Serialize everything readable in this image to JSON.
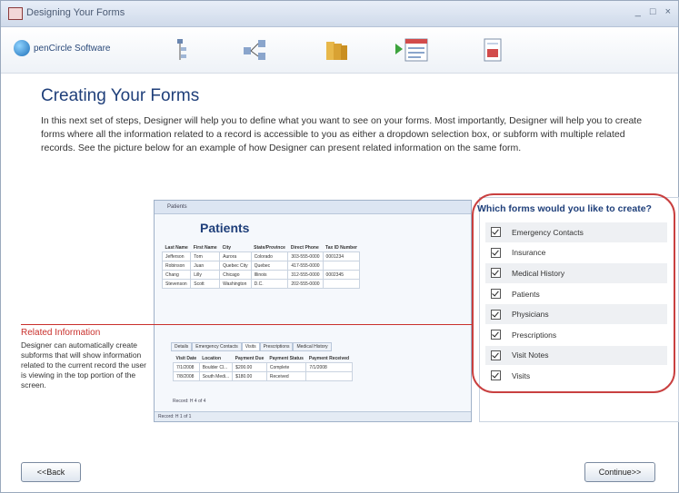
{
  "window": {
    "title": "Designing Your Forms",
    "controls": [
      "_",
      "□",
      "×"
    ]
  },
  "toolbar": {
    "logo_text": "penCircle Software",
    "steps": [
      "tree-icon",
      "diagram-icon",
      "folders-icon",
      "form-icon",
      "report-icon"
    ]
  },
  "heading": "Creating Your Forms",
  "intro": "In this next set of steps, Designer will help you to define what you want to see on your forms.  Most importantly, Designer will help you to create forms where all the information related to a record is accessible to you as either a dropdown selection box, or subform with multiple related records.  See the picture below for  an example of how Designer can present related information on the same form.",
  "preview": {
    "window_title": "Patients",
    "heading": "Patients",
    "columns": [
      "Last Name",
      "First Name",
      "City",
      "State/Province",
      "Direct Phone",
      "Tax ID Number"
    ],
    "rows": [
      [
        "Jefferson",
        "Tom",
        "Aurora",
        "Colorado",
        "303-555-0000",
        "0001234"
      ],
      [
        "Robinson",
        "Juan",
        "Quebec City",
        "Quebec",
        "417-555-0000",
        ""
      ],
      [
        "Chang",
        "Lilly",
        "Chicago",
        "Illinois",
        "312-555-0000",
        "0002345"
      ],
      [
        "Stevenson",
        "Scott",
        "Washington",
        "D.C.",
        "202-555-0000",
        ""
      ]
    ],
    "subtabs": [
      "Details",
      "Emergency Contacts",
      "Visits",
      "Prescriptions",
      "Medical History"
    ],
    "sub_columns": [
      "Visit Date",
      "Location",
      "Payment Due",
      "Payment Status",
      "Payment Received"
    ],
    "sub_rows": [
      [
        "7/1/2008",
        "Boulder Cl...",
        "$200.00",
        "Complete",
        "7/1/2008"
      ],
      [
        "7/8/2008",
        "South Medi...",
        "$180.00",
        "Received",
        ""
      ]
    ],
    "record_nav": "Record: H 4 of 4",
    "outer_nav": "Record: H 1 of 1"
  },
  "related": {
    "title": "Related Information",
    "text": "Designer can automatically create subforms that will show information related to the current record the user is viewing in the top portion of the screen."
  },
  "panel": {
    "question": "Which forms would you like to create?",
    "items": [
      {
        "label": "Emergency Contacts",
        "checked": true
      },
      {
        "label": "Insurance",
        "checked": true
      },
      {
        "label": "Medical History",
        "checked": true
      },
      {
        "label": "Patients",
        "checked": true
      },
      {
        "label": "Physicians",
        "checked": true
      },
      {
        "label": "Prescriptions",
        "checked": true
      },
      {
        "label": "Visit Notes",
        "checked": true
      },
      {
        "label": "Visits",
        "checked": true
      }
    ]
  },
  "buttons": {
    "back": "<<Back",
    "continue": "Continue>>"
  },
  "colors": {
    "accent": "#1f3f7a",
    "highlight": "#c9302c"
  }
}
